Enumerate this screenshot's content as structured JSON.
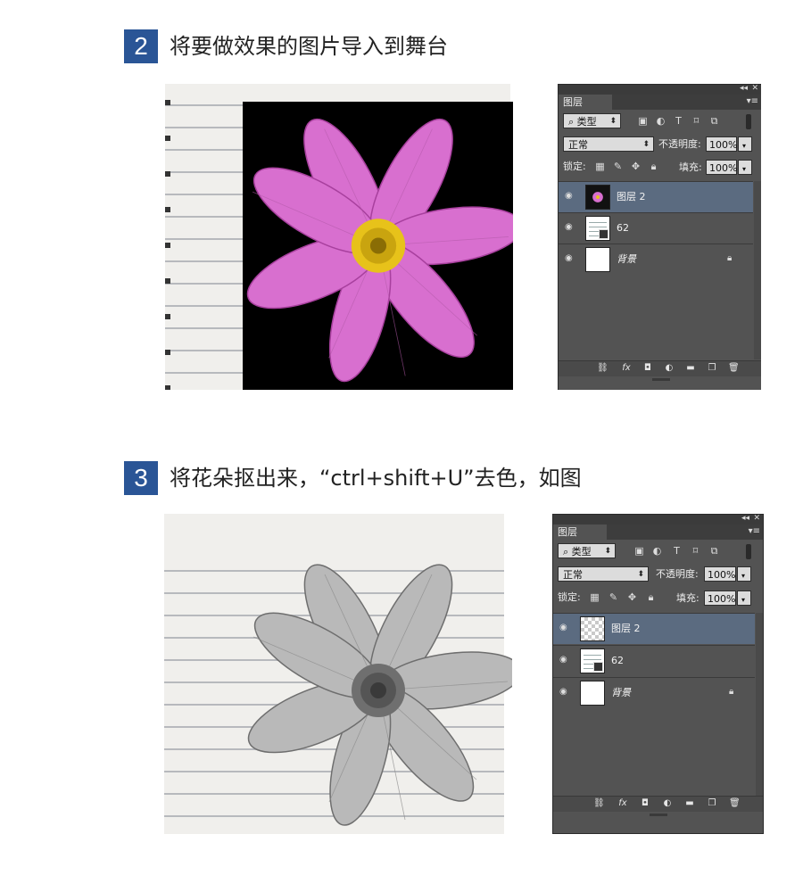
{
  "step2": {
    "number": "2",
    "text": "将要做效果的图片导入到舞台"
  },
  "step3": {
    "number": "3",
    "text": "将花朵抠出来，“ctrl+shift+U”去色，如图"
  },
  "panel": {
    "tab_label": "图层",
    "collapse_icon": "double-chevron-left-icon",
    "close_icon": "close-icon",
    "menu_icon": "panel-menu-icon",
    "filter_kind": "类型",
    "filter_icons": [
      "image-filter-icon",
      "adjustment-filter-icon",
      "type-filter-icon",
      "shape-filter-icon",
      "smart-object-filter-icon"
    ],
    "blend_mode": "正常",
    "opacity_label": "不透明度:",
    "opacity_value": "100%",
    "lock_label": "锁定:",
    "fill_label": "填充:",
    "fill_value": "100%",
    "layers": [
      {
        "name": "图层 2",
        "selected": true,
        "thumb": "checker"
      },
      {
        "name": "62",
        "selected": false,
        "thumb": "doc"
      },
      {
        "name": "背景",
        "selected": false,
        "thumb": "white",
        "locked": true
      }
    ],
    "bottom_icons": [
      "link-layers-icon",
      "fx-icon",
      "mask-icon",
      "adjustment-layer-icon",
      "group-folder-icon",
      "new-layer-icon",
      "trash-icon"
    ]
  },
  "colors": {
    "step_badge": "#2a5596",
    "panel_bg": "#535353",
    "selected_layer": "#5b6b80",
    "flower_pink": "#d86fcf",
    "flower_center": "#e7c21a"
  }
}
